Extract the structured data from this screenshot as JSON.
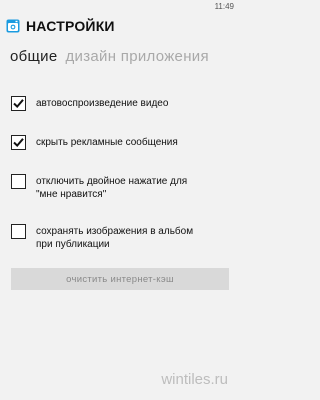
{
  "status": {
    "time": "11:49"
  },
  "header": {
    "title": "НАСТРОЙКИ",
    "logo_icon": "instagram-icon",
    "accent": "#1a9be0"
  },
  "pivot": [
    {
      "label": "общие",
      "active": true
    },
    {
      "label": "дизайн приложения",
      "active": false
    }
  ],
  "options": [
    {
      "label_lines": [
        "автовоспроизведение видео"
      ],
      "checked": true
    },
    {
      "label_lines": [
        "скрыть рекламные сообщения"
      ],
      "checked": true
    },
    {
      "label_lines": [
        "отключить двойное нажатие для",
        "\"мне нравится\""
      ],
      "checked": false
    },
    {
      "label_lines": [
        "сохранять изображения в альбом",
        "при публикации"
      ],
      "checked": false
    }
  ],
  "clear_cache_button": {
    "label": "очистить интернет-кэш"
  },
  "watermark": "wintiles.ru"
}
